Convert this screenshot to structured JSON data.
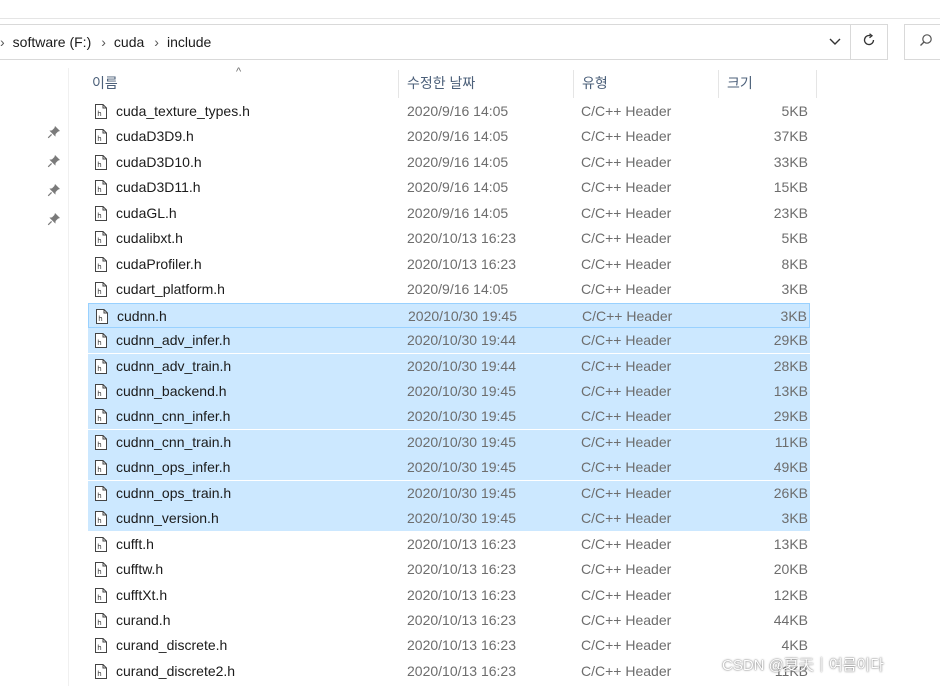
{
  "breadcrumb": [
    "software (F:)",
    "cuda",
    "include"
  ],
  "columns": {
    "name": "이름",
    "date": "수정한 날짜",
    "type": "유형",
    "size": "크기"
  },
  "files": [
    {
      "name": "cuda_texture_types.h",
      "date": "2020/9/16 14:05",
      "type": "C/C++ Header",
      "size": "5KB",
      "selected": false
    },
    {
      "name": "cudaD3D9.h",
      "date": "2020/9/16 14:05",
      "type": "C/C++ Header",
      "size": "37KB",
      "selected": false
    },
    {
      "name": "cudaD3D10.h",
      "date": "2020/9/16 14:05",
      "type": "C/C++ Header",
      "size": "33KB",
      "selected": false
    },
    {
      "name": "cudaD3D11.h",
      "date": "2020/9/16 14:05",
      "type": "C/C++ Header",
      "size": "15KB",
      "selected": false
    },
    {
      "name": "cudaGL.h",
      "date": "2020/9/16 14:05",
      "type": "C/C++ Header",
      "size": "23KB",
      "selected": false
    },
    {
      "name": "cudalibxt.h",
      "date": "2020/10/13 16:23",
      "type": "C/C++ Header",
      "size": "5KB",
      "selected": false
    },
    {
      "name": "cudaProfiler.h",
      "date": "2020/10/13 16:23",
      "type": "C/C++ Header",
      "size": "8KB",
      "selected": false
    },
    {
      "name": "cudart_platform.h",
      "date": "2020/9/16 14:05",
      "type": "C/C++ Header",
      "size": "3KB",
      "selected": false
    },
    {
      "name": "cudnn.h",
      "date": "2020/10/30 19:45",
      "type": "C/C++ Header",
      "size": "3KB",
      "selected": true
    },
    {
      "name": "cudnn_adv_infer.h",
      "date": "2020/10/30 19:44",
      "type": "C/C++ Header",
      "size": "29KB",
      "selected": true
    },
    {
      "name": "cudnn_adv_train.h",
      "date": "2020/10/30 19:44",
      "type": "C/C++ Header",
      "size": "28KB",
      "selected": true
    },
    {
      "name": "cudnn_backend.h",
      "date": "2020/10/30 19:45",
      "type": "C/C++ Header",
      "size": "13KB",
      "selected": true
    },
    {
      "name": "cudnn_cnn_infer.h",
      "date": "2020/10/30 19:45",
      "type": "C/C++ Header",
      "size": "29KB",
      "selected": true
    },
    {
      "name": "cudnn_cnn_train.h",
      "date": "2020/10/30 19:45",
      "type": "C/C++ Header",
      "size": "11KB",
      "selected": true
    },
    {
      "name": "cudnn_ops_infer.h",
      "date": "2020/10/30 19:45",
      "type": "C/C++ Header",
      "size": "49KB",
      "selected": true
    },
    {
      "name": "cudnn_ops_train.h",
      "date": "2020/10/30 19:45",
      "type": "C/C++ Header",
      "size": "26KB",
      "selected": true
    },
    {
      "name": "cudnn_version.h",
      "date": "2020/10/30 19:45",
      "type": "C/C++ Header",
      "size": "3KB",
      "selected": true
    },
    {
      "name": "cufft.h",
      "date": "2020/10/13 16:23",
      "type": "C/C++ Header",
      "size": "13KB",
      "selected": false
    },
    {
      "name": "cufftw.h",
      "date": "2020/10/13 16:23",
      "type": "C/C++ Header",
      "size": "20KB",
      "selected": false
    },
    {
      "name": "cufftXt.h",
      "date": "2020/10/13 16:23",
      "type": "C/C++ Header",
      "size": "12KB",
      "selected": false
    },
    {
      "name": "curand.h",
      "date": "2020/10/13 16:23",
      "type": "C/C++ Header",
      "size": "44KB",
      "selected": false
    },
    {
      "name": "curand_discrete.h",
      "date": "2020/10/13 16:23",
      "type": "C/C++ Header",
      "size": "4KB",
      "selected": false
    },
    {
      "name": "curand_discrete2.h",
      "date": "2020/10/13 16:23",
      "type": "C/C++ Header",
      "size": "11KB",
      "selected": false
    }
  ],
  "watermark": "CSDN @夏天｜여름이다",
  "icons": {
    "pin": "pin-icon",
    "file": "header-file-icon",
    "refresh": "refresh-icon",
    "search": "search-icon",
    "dropdown": "chevron-down-icon"
  },
  "colors": {
    "selection": "#cce8ff",
    "selection_border": "#99d1ff",
    "header_text": "#4c607a",
    "secondary_text": "#6d6d6d"
  }
}
